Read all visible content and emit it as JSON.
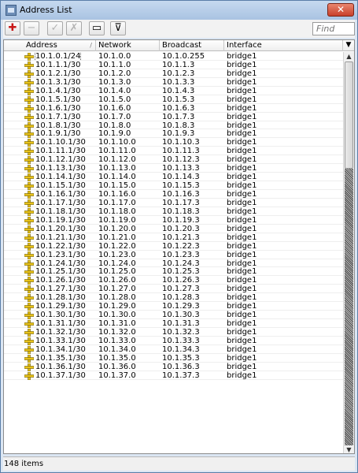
{
  "window": {
    "title": "Address List",
    "close_label": "✕"
  },
  "toolbar": {
    "add_label": "✚",
    "remove_label": "−",
    "enable_label": "✓",
    "disable_label": "✗",
    "comment_label": "▭",
    "filter_label": "⊽",
    "find_placeholder": "Find"
  },
  "table": {
    "columns": [
      "Address",
      "Network",
      "Broadcast",
      "Interface"
    ],
    "rows": [
      {
        "address": "10.1.0.1/24",
        "network": "10.1.0.0",
        "broadcast": "10.1.0.255",
        "interface": "bridge1"
      },
      {
        "address": "10.1.1.1/30",
        "network": "10.1.1.0",
        "broadcast": "10.1.1.3",
        "interface": "bridge1"
      },
      {
        "address": "10.1.2.1/30",
        "network": "10.1.2.0",
        "broadcast": "10.1.2.3",
        "interface": "bridge1"
      },
      {
        "address": "10.1.3.1/30",
        "network": "10.1.3.0",
        "broadcast": "10.1.3.3",
        "interface": "bridge1"
      },
      {
        "address": "10.1.4.1/30",
        "network": "10.1.4.0",
        "broadcast": "10.1.4.3",
        "interface": "bridge1"
      },
      {
        "address": "10.1.5.1/30",
        "network": "10.1.5.0",
        "broadcast": "10.1.5.3",
        "interface": "bridge1"
      },
      {
        "address": "10.1.6.1/30",
        "network": "10.1.6.0",
        "broadcast": "10.1.6.3",
        "interface": "bridge1"
      },
      {
        "address": "10.1.7.1/30",
        "network": "10.1.7.0",
        "broadcast": "10.1.7.3",
        "interface": "bridge1"
      },
      {
        "address": "10.1.8.1/30",
        "network": "10.1.8.0",
        "broadcast": "10.1.8.3",
        "interface": "bridge1"
      },
      {
        "address": "10.1.9.1/30",
        "network": "10.1.9.0",
        "broadcast": "10.1.9.3",
        "interface": "bridge1"
      },
      {
        "address": "10.1.10.1/30",
        "network": "10.1.10.0",
        "broadcast": "10.1.10.3",
        "interface": "bridge1"
      },
      {
        "address": "10.1.11.1/30",
        "network": "10.1.11.0",
        "broadcast": "10.1.11.3",
        "interface": "bridge1"
      },
      {
        "address": "10.1.12.1/30",
        "network": "10.1.12.0",
        "broadcast": "10.1.12.3",
        "interface": "bridge1"
      },
      {
        "address": "10.1.13.1/30",
        "network": "10.1.13.0",
        "broadcast": "10.1.13.3",
        "interface": "bridge1"
      },
      {
        "address": "10.1.14.1/30",
        "network": "10.1.14.0",
        "broadcast": "10.1.14.3",
        "interface": "bridge1"
      },
      {
        "address": "10.1.15.1/30",
        "network": "10.1.15.0",
        "broadcast": "10.1.15.3",
        "interface": "bridge1"
      },
      {
        "address": "10.1.16.1/30",
        "network": "10.1.16.0",
        "broadcast": "10.1.16.3",
        "interface": "bridge1"
      },
      {
        "address": "10.1.17.1/30",
        "network": "10.1.17.0",
        "broadcast": "10.1.17.3",
        "interface": "bridge1"
      },
      {
        "address": "10.1.18.1/30",
        "network": "10.1.18.0",
        "broadcast": "10.1.18.3",
        "interface": "bridge1"
      },
      {
        "address": "10.1.19.1/30",
        "network": "10.1.19.0",
        "broadcast": "10.1.19.3",
        "interface": "bridge1"
      },
      {
        "address": "10.1.20.1/30",
        "network": "10.1.20.0",
        "broadcast": "10.1.20.3",
        "interface": "bridge1"
      },
      {
        "address": "10.1.21.1/30",
        "network": "10.1.21.0",
        "broadcast": "10.1.21.3",
        "interface": "bridge1"
      },
      {
        "address": "10.1.22.1/30",
        "network": "10.1.22.0",
        "broadcast": "10.1.22.3",
        "interface": "bridge1"
      },
      {
        "address": "10.1.23.1/30",
        "network": "10.1.23.0",
        "broadcast": "10.1.23.3",
        "interface": "bridge1"
      },
      {
        "address": "10.1.24.1/30",
        "network": "10.1.24.0",
        "broadcast": "10.1.24.3",
        "interface": "bridge1"
      },
      {
        "address": "10.1.25.1/30",
        "network": "10.1.25.0",
        "broadcast": "10.1.25.3",
        "interface": "bridge1"
      },
      {
        "address": "10.1.26.1/30",
        "network": "10.1.26.0",
        "broadcast": "10.1.26.3",
        "interface": "bridge1"
      },
      {
        "address": "10.1.27.1/30",
        "network": "10.1.27.0",
        "broadcast": "10.1.27.3",
        "interface": "bridge1"
      },
      {
        "address": "10.1.28.1/30",
        "network": "10.1.28.0",
        "broadcast": "10.1.28.3",
        "interface": "bridge1"
      },
      {
        "address": "10.1.29.1/30",
        "network": "10.1.29.0",
        "broadcast": "10.1.29.3",
        "interface": "bridge1"
      },
      {
        "address": "10.1.30.1/30",
        "network": "10.1.30.0",
        "broadcast": "10.1.30.3",
        "interface": "bridge1"
      },
      {
        "address": "10.1.31.1/30",
        "network": "10.1.31.0",
        "broadcast": "10.1.31.3",
        "interface": "bridge1"
      },
      {
        "address": "10.1.32.1/30",
        "network": "10.1.32.0",
        "broadcast": "10.1.32.3",
        "interface": "bridge1"
      },
      {
        "address": "10.1.33.1/30",
        "network": "10.1.33.0",
        "broadcast": "10.1.33.3",
        "interface": "bridge1"
      },
      {
        "address": "10.1.34.1/30",
        "network": "10.1.34.0",
        "broadcast": "10.1.34.3",
        "interface": "bridge1"
      },
      {
        "address": "10.1.35.1/30",
        "network": "10.1.35.0",
        "broadcast": "10.1.35.3",
        "interface": "bridge1"
      },
      {
        "address": "10.1.36.1/30",
        "network": "10.1.36.0",
        "broadcast": "10.1.36.3",
        "interface": "bridge1"
      },
      {
        "address": "10.1.37.1/30",
        "network": "10.1.37.0",
        "broadcast": "10.1.37.3",
        "interface": "bridge1"
      }
    ]
  },
  "status": {
    "items_count": "148 items"
  }
}
